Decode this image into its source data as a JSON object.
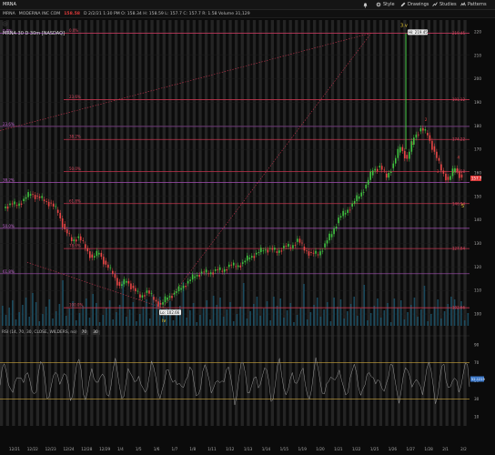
{
  "toolbar": {
    "symbol_input": "MRNA",
    "items": [
      {
        "label": "",
        "icon": "bell-icon"
      },
      {
        "label": "Style",
        "icon": "gear-icon"
      },
      {
        "label": "Drawings",
        "icon": "pencil-icon"
      },
      {
        "label": "Studies",
        "icon": "studies-icon"
      },
      {
        "label": "Patterns",
        "icon": "patterns-icon"
      }
    ]
  },
  "header": {
    "company": "MODERNA INC COM",
    "price": "158.58",
    "info": "D 2/2/21 1:30 PM   O: 158.34   H: 158.59   L: 157.7   C: 157.7   R: 1.58   Volume 31,129",
    "chart_title": "MRNA 30 D 30m [NASDAQ]",
    "price_color": "#e23b3b"
  },
  "chart_data": {
    "type": "line",
    "price_axis": {
      "min": 95,
      "max": 225,
      "ticks": [
        100,
        110,
        120,
        130,
        140,
        150,
        160,
        170,
        180,
        190,
        200,
        210,
        220
      ]
    },
    "x_ticks": [
      "12/21",
      "12/22",
      "12/23",
      "12/24",
      "12/28",
      "12/29",
      "1/4",
      "1/5",
      "1/6",
      "1/7",
      "1/8",
      "1/11",
      "1/12",
      "1/13",
      "1/14",
      "1/15",
      "1/19",
      "1/20",
      "1/21",
      "1/22",
      "1/25",
      "1/26",
      "1/27",
      "1/28",
      "2/1",
      "2/2"
    ],
    "price_series": [
      [
        0,
        145
      ],
      [
        1,
        147
      ],
      [
        2,
        146
      ],
      [
        3,
        149
      ],
      [
        4,
        151
      ],
      [
        5,
        150
      ],
      [
        6,
        148
      ],
      [
        7,
        147
      ],
      [
        8,
        143
      ],
      [
        9,
        136
      ],
      [
        10,
        131
      ],
      [
        11,
        133
      ],
      [
        12,
        128
      ],
      [
        13,
        124
      ],
      [
        14,
        126
      ],
      [
        15,
        121
      ],
      [
        16,
        117
      ],
      [
        17,
        112
      ],
      [
        18,
        114
      ],
      [
        19,
        111
      ],
      [
        20,
        107
      ],
      [
        21,
        110
      ],
      [
        22,
        106
      ],
      [
        23,
        104
      ],
      [
        24,
        107
      ],
      [
        25,
        109
      ],
      [
        26,
        111
      ],
      [
        27,
        114
      ],
      [
        28,
        116
      ],
      [
        29,
        118
      ],
      [
        30,
        117
      ],
      [
        31,
        119
      ],
      [
        32,
        118
      ],
      [
        33,
        121
      ],
      [
        34,
        120
      ],
      [
        35,
        122
      ],
      [
        36,
        124
      ],
      [
        37,
        126
      ],
      [
        38,
        127
      ],
      [
        39,
        128
      ],
      [
        40,
        126
      ],
      [
        41,
        129
      ],
      [
        42,
        128
      ],
      [
        43,
        132
      ],
      [
        44,
        127
      ],
      [
        45,
        126
      ],
      [
        46,
        125
      ],
      [
        47,
        130
      ],
      [
        48,
        134
      ],
      [
        49,
        141
      ],
      [
        50,
        143
      ],
      [
        51,
        147
      ],
      [
        52,
        150
      ],
      [
        53,
        155
      ],
      [
        54,
        161
      ],
      [
        55,
        163
      ],
      [
        56,
        158
      ],
      [
        57,
        164
      ],
      [
        58,
        171
      ],
      [
        59,
        166
      ],
      [
        60,
        175
      ],
      [
        61,
        179
      ],
      [
        62,
        176
      ],
      [
        63,
        169
      ],
      [
        64,
        161
      ],
      [
        65,
        157
      ],
      [
        66,
        162
      ],
      [
        67,
        158
      ]
    ],
    "spike": {
      "x": 58.5,
      "high": 219.45
    },
    "fib_lines": [
      {
        "pct": "0.0%",
        "value": 219.45,
        "label": "219.45"
      },
      {
        "pct": "23.6%",
        "value": 191.12,
        "label": "191.12"
      },
      {
        "pct": "38.2%",
        "value": 174.22,
        "label": "174.22"
      },
      {
        "pct": "50.0%",
        "value": 160.58,
        "label": "160.58"
      },
      {
        "pct": "61.8%",
        "value": 146.94,
        "label": "146.94"
      },
      {
        "pct": "78.6%",
        "value": 127.84,
        "label": "127.84"
      },
      {
        "pct": "100.0%",
        "value": 102.66,
        "label": "102.66"
      }
    ],
    "purple_lines": [
      {
        "pct": "0.0%",
        "value": 219.45
      },
      {
        "pct": "23.6%",
        "value": 179.75
      },
      {
        "pct": "38.2%",
        "value": 156.0
      },
      {
        "pct": "50.0%",
        "value": 136.46
      },
      {
        "pct": "61.8%",
        "value": 117.12
      }
    ],
    "annotations": {
      "high_label": "Hi: 219.45",
      "low_label": "Lo: 102.66",
      "wave_3": "3.v",
      "wave_4": "iv",
      "wave_5": "5",
      "b_labels": [
        "b?",
        "b?",
        "b?"
      ],
      "wave_small": [
        "1",
        "2",
        "3",
        "4"
      ]
    },
    "current_price_tag": "157.7"
  },
  "indicator": {
    "legend": "RSI (14, 70, 30, CLOSE, WILDERS, no)",
    "value": "52.1219",
    "level_high": "70",
    "level_low": "30",
    "axis_ticks": [
      "90",
      "70",
      "50",
      "30",
      "10"
    ]
  }
}
